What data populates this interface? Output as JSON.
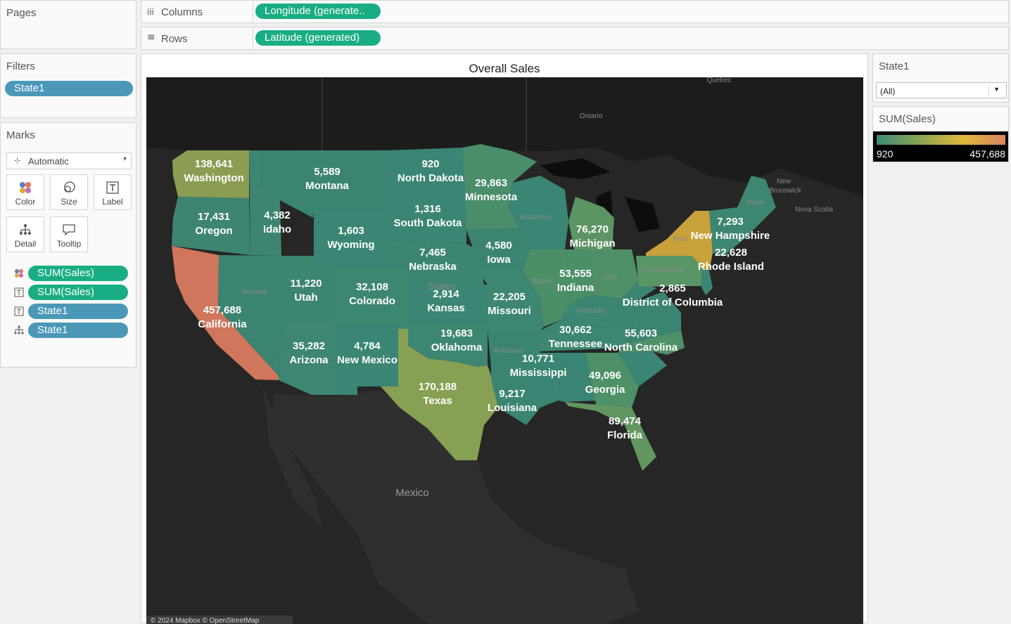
{
  "pages": {
    "title": "Pages"
  },
  "columns": {
    "icon": "iii",
    "label": "Columns",
    "pill": "Longitude (generate.."
  },
  "rows": {
    "icon": "≡",
    "label": "Rows",
    "pill": "Latitude (generated)"
  },
  "filters": {
    "title": "Filters",
    "items": [
      "State1"
    ]
  },
  "marks": {
    "title": "Marks",
    "mark_type": "Automatic",
    "buttons": [
      "Color",
      "Size",
      "Label",
      "Detail",
      "Tooltip"
    ],
    "fields": [
      {
        "icon": "color-icon",
        "label": "SUM(Sales)",
        "kind": "measure"
      },
      {
        "icon": "label-icon",
        "label": "SUM(Sales)",
        "kind": "measure"
      },
      {
        "icon": "label-icon",
        "label": "State1",
        "kind": "dimension"
      },
      {
        "icon": "detail-icon",
        "label": "State1",
        "kind": "dimension"
      }
    ]
  },
  "view": {
    "title": "Overall Sales",
    "attribution": "© 2024 Mapbox © OpenStreetMap"
  },
  "state_filter": {
    "title": "State1",
    "value": "(All)"
  },
  "legend": {
    "title": "SUM(Sales)",
    "min": "920",
    "max": "457,688",
    "colors": [
      "#3e8a78",
      "#8aa453",
      "#e0b83a",
      "#d98462"
    ]
  },
  "geo_labels": {
    "quebec": "Quebec",
    "ontario": "Ontario",
    "new_brunswick_1": "New",
    "new_brunswick_2": "Brunswick",
    "nova_scotia": "Nova Scotia",
    "maine": "Maine",
    "wisconsin": "Wisconsin",
    "illinois": "Illinois",
    "ohio": "Ohio",
    "kentucky": "Kentucky",
    "pennsylvania": "Pennsylvania",
    "arkansas": "Arkansas",
    "nevada": "Nevada",
    "mexico": "Mexico",
    "states": "States",
    "new": "New"
  },
  "states": [
    {
      "name": "Washington",
      "value": "138,641"
    },
    {
      "name": "Montana",
      "value": "5,589"
    },
    {
      "name": "North Dakota",
      "value": "920"
    },
    {
      "name": "Minnesota",
      "value": "29,863"
    },
    {
      "name": "Oregon",
      "value": "17,431"
    },
    {
      "name": "Idaho",
      "value": "4,382"
    },
    {
      "name": "South Dakota",
      "value": "1,316"
    },
    {
      "name": "Wyoming",
      "value": "1,603"
    },
    {
      "name": "Nebraska",
      "value": "7,465"
    },
    {
      "name": "Iowa",
      "value": "4,580"
    },
    {
      "name": "Michigan",
      "value": "76,270"
    },
    {
      "name": "New Hampshire",
      "value": "7,293"
    },
    {
      "name": "Rhode Island",
      "value": "22,628"
    },
    {
      "name": "Indiana",
      "value": "53,555"
    },
    {
      "name": "Utah",
      "value": "11,220"
    },
    {
      "name": "Colorado",
      "value": "32,108"
    },
    {
      "name": "Kansas",
      "value": "2,914"
    },
    {
      "name": "Missouri",
      "value": "22,205"
    },
    {
      "name": "District of Columbia",
      "value": "2,865"
    },
    {
      "name": "California",
      "value": "457,688"
    },
    {
      "name": "Tennessee",
      "value": "30,662"
    },
    {
      "name": "North Carolina",
      "value": "55,603"
    },
    {
      "name": "Oklahoma",
      "value": "19,683"
    },
    {
      "name": "Arizona",
      "value": "35,282"
    },
    {
      "name": "New Mexico",
      "value": "4,784"
    },
    {
      "name": "Mississippi",
      "value": "10,771"
    },
    {
      "name": "Georgia",
      "value": "49,096"
    },
    {
      "name": "Texas",
      "value": "170,188"
    },
    {
      "name": "Louisiana",
      "value": "9,217"
    },
    {
      "name": "Florida",
      "value": "89,474"
    }
  ]
}
